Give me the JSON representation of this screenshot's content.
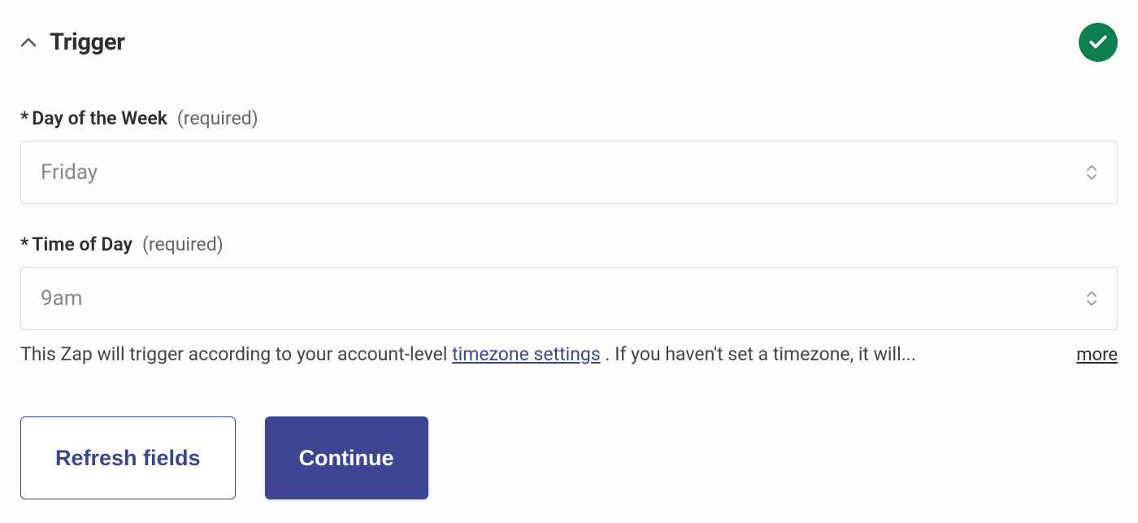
{
  "section": {
    "title": "Trigger"
  },
  "fields": {
    "day_of_week": {
      "label": "Day of the Week",
      "required_text": "(required)",
      "value": "Friday"
    },
    "time_of_day": {
      "label": "Time of Day",
      "required_text": "(required)",
      "value": "9am"
    }
  },
  "helper": {
    "text_before": "This Zap will trigger according to your account-level ",
    "link_text": "timezone settings",
    "text_after": " . If you haven't set a timezone, it will...",
    "more_label": "more"
  },
  "buttons": {
    "refresh": "Refresh fields",
    "continue": "Continue"
  }
}
